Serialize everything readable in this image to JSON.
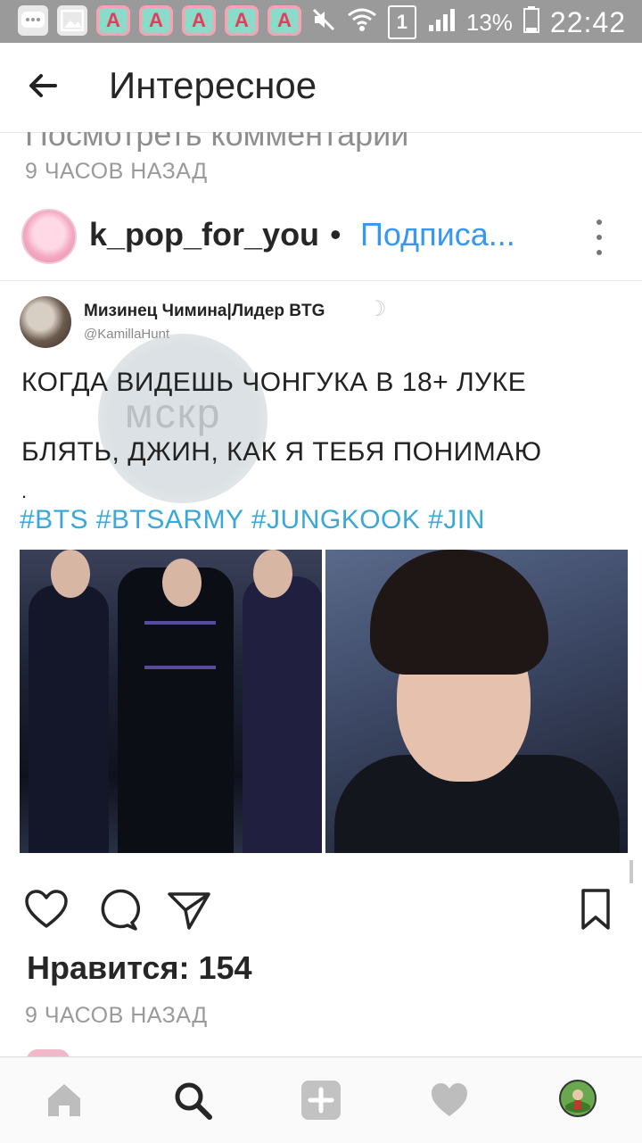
{
  "status_bar": {
    "battery": "13%",
    "time": "22:42",
    "sim": "1",
    "app_icon_letter": "A",
    "icons": [
      "chat-icon",
      "image-icon",
      "app-icon",
      "app-icon",
      "app-icon",
      "app-icon",
      "app-icon",
      "mute-icon",
      "wifi-icon",
      "signal-icon",
      "battery-icon"
    ]
  },
  "header": {
    "title": "Интересное"
  },
  "previous_post": {
    "cut_text": "Посмотреть комментарии",
    "time": "9 ЧАСОВ НАЗАД"
  },
  "post": {
    "username": "k_pop_for_you",
    "separator": "•",
    "follow_label": "Подписа...",
    "tweet": {
      "name": "Мизинец Чимина|Лидер BTG",
      "handle": "@KamillaHunt",
      "line1": "КОГДА ВИДЕШЬ ЧОНГУКА В 18+ ЛУКЕ",
      "line2": "БЛЯТЬ, ДЖИН, КАК Я ТЕБЯ ПОНИМАЮ",
      "dot": ".",
      "hashtags": "#BTS #BTSARMY #JUNGKOOK #JIN",
      "watermark": "мскр"
    },
    "likes": "Нравится: 154",
    "time": "9 ЧАСОВ НАЗАД"
  },
  "colors": {
    "link_blue": "#3897f0",
    "hashtag_blue": "#3aa8d8",
    "status_bar": "#9a9a9a"
  }
}
